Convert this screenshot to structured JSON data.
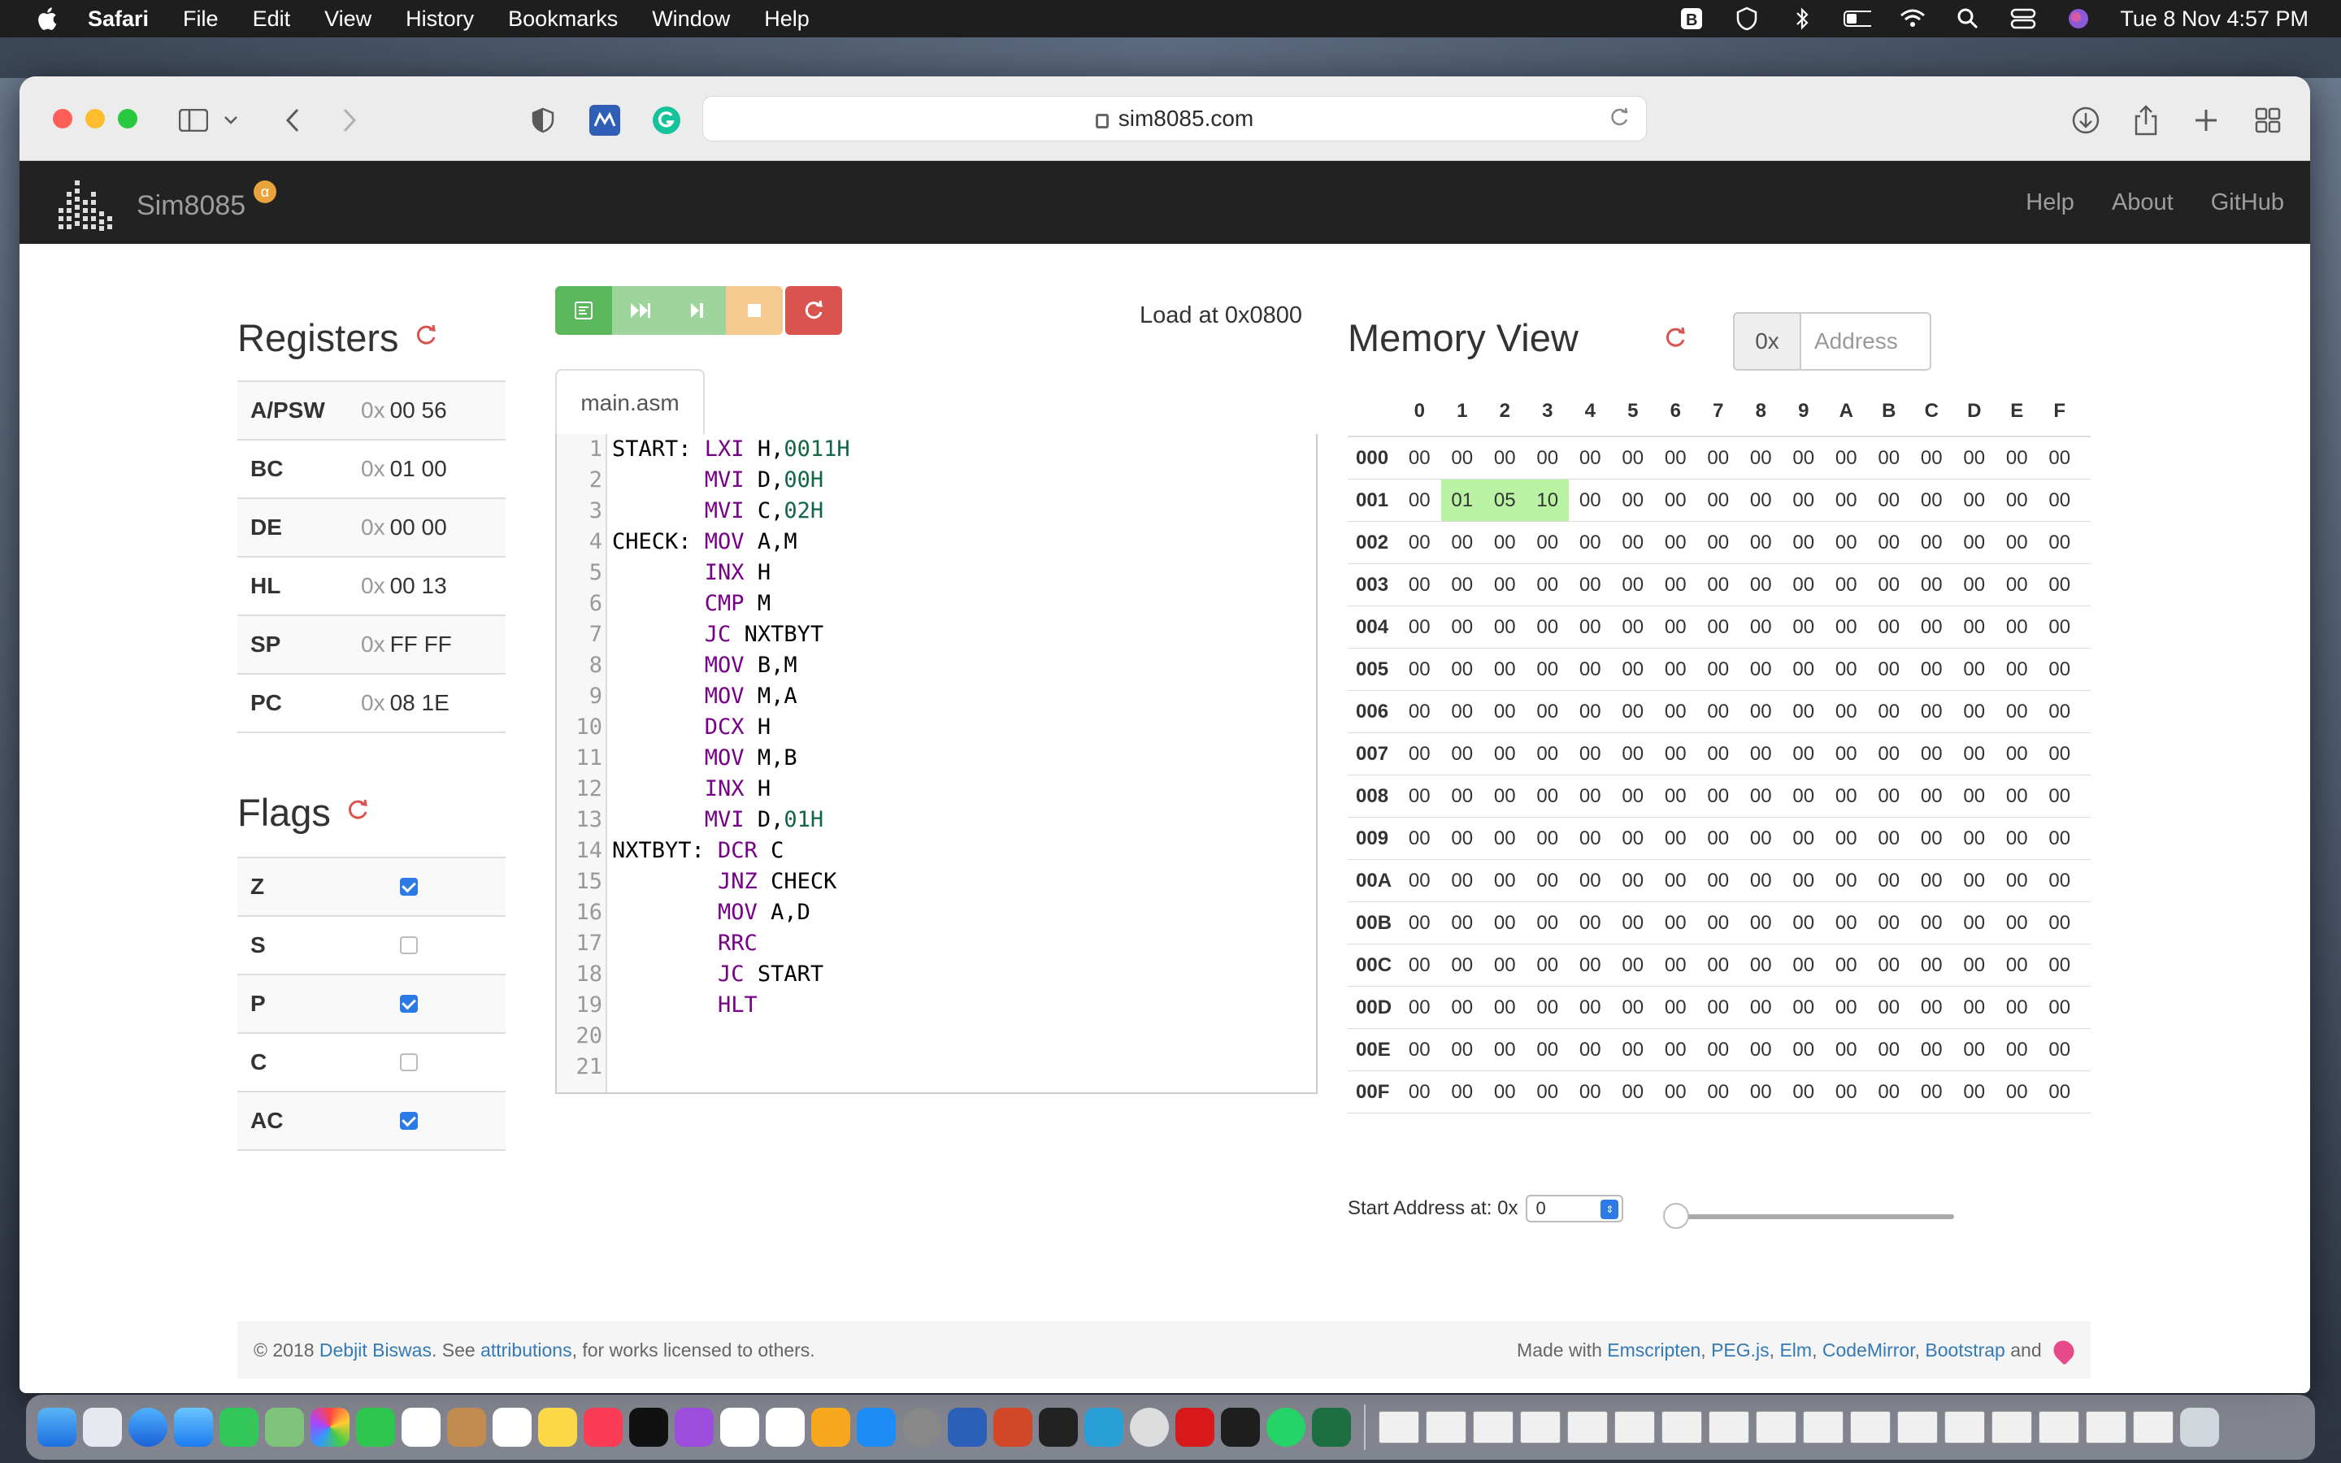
{
  "menubar": {
    "app_name": "Safari",
    "items": [
      "File",
      "Edit",
      "View",
      "History",
      "Bookmarks",
      "Window",
      "Help"
    ],
    "datetime": "Tue 8 Nov  4:57 PM"
  },
  "browser": {
    "url": "sim8085.com"
  },
  "navbar": {
    "brand": "Sim8085",
    "badge": "α",
    "links": [
      "Help",
      "About",
      "GitHub"
    ]
  },
  "registers": {
    "title": "Registers",
    "prefix": "0x",
    "rows": [
      {
        "name": "A/PSW",
        "value": "00 56"
      },
      {
        "name": "BC",
        "value": "01 00"
      },
      {
        "name": "DE",
        "value": "00 00"
      },
      {
        "name": "HL",
        "value": "00 13"
      },
      {
        "name": "SP",
        "value": "FF FF"
      },
      {
        "name": "PC",
        "value": "08 1E"
      }
    ]
  },
  "flags": {
    "title": "Flags",
    "rows": [
      {
        "name": "Z",
        "checked": true
      },
      {
        "name": "S",
        "checked": false
      },
      {
        "name": "P",
        "checked": true
      },
      {
        "name": "C",
        "checked": false
      },
      {
        "name": "AC",
        "checked": true
      }
    ]
  },
  "editor": {
    "load_at": "Load at 0x0800",
    "tab": "main.asm",
    "buttons": [
      {
        "name": "assemble-button",
        "icon": "assemble-icon",
        "color": "#5cb85c"
      },
      {
        "name": "run-button",
        "icon": "fast-forward-icon",
        "color": "#9dd59d"
      },
      {
        "name": "step-button",
        "icon": "step-icon",
        "color": "#9dd59d"
      },
      {
        "name": "stop-button",
        "icon": "stop-icon",
        "color": "#f6c98f"
      }
    ],
    "lines": [
      [
        {
          "t": "START: "
        },
        {
          "t": "LXI",
          "c": "kw"
        },
        {
          "t": " H,"
        },
        {
          "t": "0011H",
          "c": "num"
        }
      ],
      [
        {
          "t": "       "
        },
        {
          "t": "MVI",
          "c": "kw"
        },
        {
          "t": " D,"
        },
        {
          "t": "00H",
          "c": "num"
        }
      ],
      [
        {
          "t": "       "
        },
        {
          "t": "MVI",
          "c": "kw"
        },
        {
          "t": " C,"
        },
        {
          "t": "02H",
          "c": "num"
        }
      ],
      [
        {
          "t": "CHECK: "
        },
        {
          "t": "MOV",
          "c": "kw"
        },
        {
          "t": " A,M"
        }
      ],
      [
        {
          "t": "       "
        },
        {
          "t": "INX",
          "c": "kw"
        },
        {
          "t": " H"
        }
      ],
      [
        {
          "t": "       "
        },
        {
          "t": "CMP",
          "c": "kw"
        },
        {
          "t": " M"
        }
      ],
      [
        {
          "t": "       "
        },
        {
          "t": "JC",
          "c": "kw"
        },
        {
          "t": " NXTBYT"
        }
      ],
      [
        {
          "t": "       "
        },
        {
          "t": "MOV",
          "c": "kw"
        },
        {
          "t": " B,M"
        }
      ],
      [
        {
          "t": "       "
        },
        {
          "t": "MOV",
          "c": "kw"
        },
        {
          "t": " M,A"
        }
      ],
      [
        {
          "t": "       "
        },
        {
          "t": "DCX",
          "c": "kw"
        },
        {
          "t": " H"
        }
      ],
      [
        {
          "t": "       "
        },
        {
          "t": "MOV",
          "c": "kw"
        },
        {
          "t": " M,B"
        }
      ],
      [
        {
          "t": "       "
        },
        {
          "t": "INX",
          "c": "kw"
        },
        {
          "t": " H"
        }
      ],
      [
        {
          "t": "       "
        },
        {
          "t": "MVI",
          "c": "kw"
        },
        {
          "t": " D,"
        },
        {
          "t": "01H",
          "c": "num"
        }
      ],
      [
        {
          "t": "NXTBYT: "
        },
        {
          "t": "DCR",
          "c": "kw"
        },
        {
          "t": " C"
        }
      ],
      [
        {
          "t": "        "
        },
        {
          "t": "JNZ",
          "c": "kw"
        },
        {
          "t": " CHECK"
        }
      ],
      [
        {
          "t": "        "
        },
        {
          "t": "MOV",
          "c": "kw"
        },
        {
          "t": " A,D"
        }
      ],
      [
        {
          "t": "        "
        },
        {
          "t": "RRC",
          "c": "kw"
        }
      ],
      [
        {
          "t": "        "
        },
        {
          "t": "JC",
          "c": "kw"
        },
        {
          "t": " START"
        }
      ],
      [
        {
          "t": "        "
        },
        {
          "t": "HLT",
          "c": "kw"
        }
      ],
      [],
      []
    ]
  },
  "memory": {
    "title": "Memory View",
    "addr_prefix": "0x",
    "addr_placeholder": "Address",
    "columns": [
      "0",
      "1",
      "2",
      "3",
      "4",
      "5",
      "6",
      "7",
      "8",
      "9",
      "A",
      "B",
      "C",
      "D",
      "E",
      "F"
    ],
    "rows": [
      {
        "addr": "000",
        "cells": [
          "00",
          "00",
          "00",
          "00",
          "00",
          "00",
          "00",
          "00",
          "00",
          "00",
          "00",
          "00",
          "00",
          "00",
          "00",
          "00"
        ],
        "highlight": []
      },
      {
        "addr": "001",
        "cells": [
          "00",
          "01",
          "05",
          "10",
          "00",
          "00",
          "00",
          "00",
          "00",
          "00",
          "00",
          "00",
          "00",
          "00",
          "00",
          "00"
        ],
        "highlight": [
          1,
          2,
          3
        ]
      },
      {
        "addr": "002",
        "cells": [
          "00",
          "00",
          "00",
          "00",
          "00",
          "00",
          "00",
          "00",
          "00",
          "00",
          "00",
          "00",
          "00",
          "00",
          "00",
          "00"
        ],
        "highlight": []
      },
      {
        "addr": "003",
        "cells": [
          "00",
          "00",
          "00",
          "00",
          "00",
          "00",
          "00",
          "00",
          "00",
          "00",
          "00",
          "00",
          "00",
          "00",
          "00",
          "00"
        ],
        "highlight": []
      },
      {
        "addr": "004",
        "cells": [
          "00",
          "00",
          "00",
          "00",
          "00",
          "00",
          "00",
          "00",
          "00",
          "00",
          "00",
          "00",
          "00",
          "00",
          "00",
          "00"
        ],
        "highlight": []
      },
      {
        "addr": "005",
        "cells": [
          "00",
          "00",
          "00",
          "00",
          "00",
          "00",
          "00",
          "00",
          "00",
          "00",
          "00",
          "00",
          "00",
          "00",
          "00",
          "00"
        ],
        "highlight": []
      },
      {
        "addr": "006",
        "cells": [
          "00",
          "00",
          "00",
          "00",
          "00",
          "00",
          "00",
          "00",
          "00",
          "00",
          "00",
          "00",
          "00",
          "00",
          "00",
          "00"
        ],
        "highlight": []
      },
      {
        "addr": "007",
        "cells": [
          "00",
          "00",
          "00",
          "00",
          "00",
          "00",
          "00",
          "00",
          "00",
          "00",
          "00",
          "00",
          "00",
          "00",
          "00",
          "00"
        ],
        "highlight": []
      },
      {
        "addr": "008",
        "cells": [
          "00",
          "00",
          "00",
          "00",
          "00",
          "00",
          "00",
          "00",
          "00",
          "00",
          "00",
          "00",
          "00",
          "00",
          "00",
          "00"
        ],
        "highlight": []
      },
      {
        "addr": "009",
        "cells": [
          "00",
          "00",
          "00",
          "00",
          "00",
          "00",
          "00",
          "00",
          "00",
          "00",
          "00",
          "00",
          "00",
          "00",
          "00",
          "00"
        ],
        "highlight": []
      },
      {
        "addr": "00A",
        "cells": [
          "00",
          "00",
          "00",
          "00",
          "00",
          "00",
          "00",
          "00",
          "00",
          "00",
          "00",
          "00",
          "00",
          "00",
          "00",
          "00"
        ],
        "highlight": []
      },
      {
        "addr": "00B",
        "cells": [
          "00",
          "00",
          "00",
          "00",
          "00",
          "00",
          "00",
          "00",
          "00",
          "00",
          "00",
          "00",
          "00",
          "00",
          "00",
          "00"
        ],
        "highlight": []
      },
      {
        "addr": "00C",
        "cells": [
          "00",
          "00",
          "00",
          "00",
          "00",
          "00",
          "00",
          "00",
          "00",
          "00",
          "00",
          "00",
          "00",
          "00",
          "00",
          "00"
        ],
        "highlight": []
      },
      {
        "addr": "00D",
        "cells": [
          "00",
          "00",
          "00",
          "00",
          "00",
          "00",
          "00",
          "00",
          "00",
          "00",
          "00",
          "00",
          "00",
          "00",
          "00",
          "00"
        ],
        "highlight": []
      },
      {
        "addr": "00E",
        "cells": [
          "00",
          "00",
          "00",
          "00",
          "00",
          "00",
          "00",
          "00",
          "00",
          "00",
          "00",
          "00",
          "00",
          "00",
          "00",
          "00"
        ],
        "highlight": []
      },
      {
        "addr": "00F",
        "cells": [
          "00",
          "00",
          "00",
          "00",
          "00",
          "00",
          "00",
          "00",
          "00",
          "00",
          "00",
          "00",
          "00",
          "00",
          "00",
          "00"
        ],
        "highlight": []
      }
    ],
    "start_label": "Start Address at: 0x",
    "start_value": "0",
    "slider_value": 0
  },
  "footer": {
    "left_prefix": "© 2018 ",
    "author": "Debjit Biswas",
    "see": ". See ",
    "attributions": "attributions",
    "left_suffix": ", for works licensed to others.",
    "made_with": "Made with ",
    "tools": [
      "Emscripten",
      "PEG.js",
      "Elm",
      "CodeMirror",
      "Bootstrap"
    ],
    "and": " and "
  },
  "colors": {
    "accent": "#337ab7",
    "danger": "#d9534f",
    "navbar": "#222222",
    "mem_highlight": "#b9f2a3"
  }
}
